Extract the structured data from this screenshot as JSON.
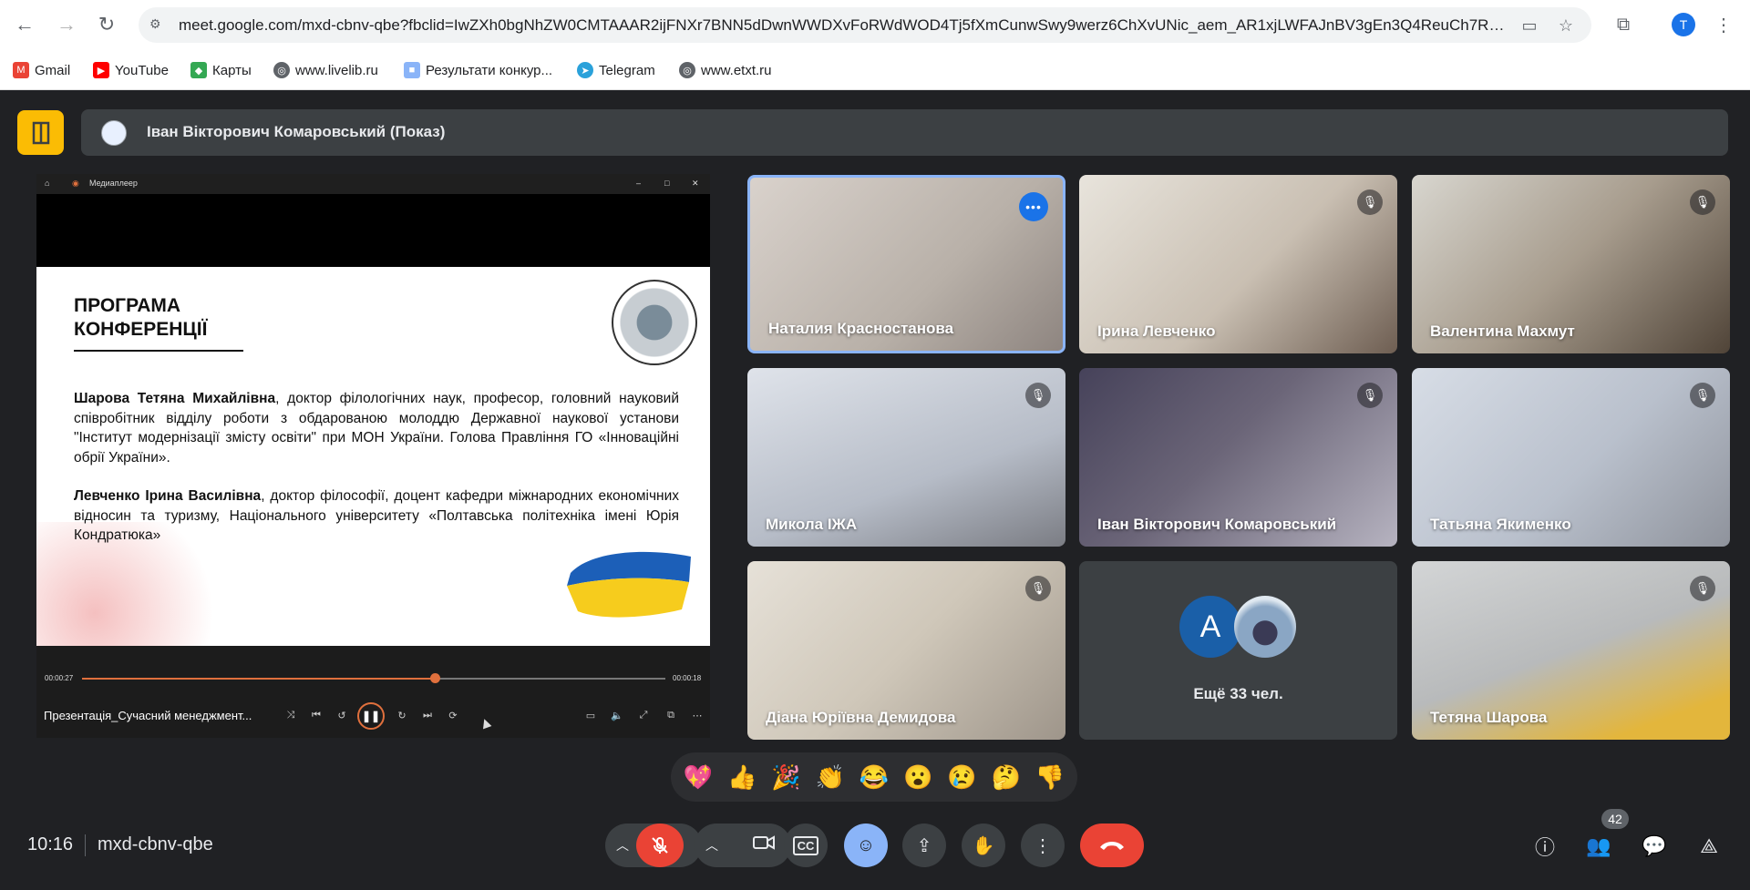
{
  "browser": {
    "url": "meet.google.com/mxd-cbnv-qbe?fbclid=IwZXh0bgNhZW0CMTAAAR2ijFNXr7BNN5dDwnWWDXvFoRWdWOD4Tj5fXmCunwSwy9werz6ChXvUNic_aem_AR1xjLWFAJnBV3gEn3Q4ReuCh7Rq_...",
    "profile_initial": "T",
    "bookmarks": [
      {
        "label": "Gmail",
        "color": "#ea4335"
      },
      {
        "label": "YouTube",
        "color": "#ff0000"
      },
      {
        "label": "Карты",
        "color": "#34a853"
      },
      {
        "label": "www.livelib.ru",
        "color": "#5f6368"
      },
      {
        "label": "Результати конкур...",
        "color": "#8ab4f8"
      },
      {
        "label": "Telegram",
        "color": "#2aa1da"
      },
      {
        "label": "www.etxt.ru",
        "color": "#5f6368"
      }
    ]
  },
  "meet": {
    "presenter_title": "Іван Вікторович Комаровський (Показ)",
    "media_player": {
      "app_name": "Медиаплеер",
      "time_elapsed": "00:00:27",
      "time_remaining": "00:00:18",
      "progress": 0.605,
      "file_name": "Презентація_Сучасний менеджмент..."
    },
    "slide": {
      "heading_line1": "ПРОГРАМА",
      "heading_line2": "КОНФЕРЕНЦІЇ",
      "p1_name": "Шарова Тетяна Михайлівна",
      "p1_text": ", доктор філологічних наук, професор, головний науковий співробітник відділу роботи з обдарованою молоддю Державної наукової установи \"Інститут модернізації змісту освіти\" при МОН України. Голова Правління ГО «Інноваційні обрії України».",
      "p2_name": "Левченко Ірина Василівна",
      "p2_text": ", доктор філософії, доцент кафедри міжнародних економічних відносин та туризму, Національного університету «Полтавська політехніка імені Юрія Кондратюка»"
    },
    "participants": [
      {
        "name": "Наталия Красностанова",
        "bg": "linear-gradient(135deg,#d9d2cc,#b8b0a8 60%,#8e8580)"
      },
      {
        "name": "Ірина Левченко",
        "bg": "linear-gradient(135deg,#e8e4dc,#c9bfb2 55%,#6e5e52)"
      },
      {
        "name": "Валентина Махмут",
        "bg": "linear-gradient(135deg,#d8d6cf,#a79c8d 50%,#504438)"
      },
      {
        "name": "Микола ІЖА",
        "bg": "linear-gradient(160deg,#dfe3ea,#b6bcc7 60%,#7b7d84)"
      },
      {
        "name": "Іван Вікторович Комаровський",
        "bg": "linear-gradient(135deg,#46425a,#6b6578 45%,#b6b3c0)"
      },
      {
        "name": "Татьяна Якименко",
        "bg": "linear-gradient(135deg,#d7dde6,#b9c0cc 55%,#8f939c)"
      },
      {
        "name": "Діана Юріївна Демидова",
        "bg": "linear-gradient(135deg,#e6e1d8,#cfc7b9 50%,#9e958a)"
      },
      {
        "name": "Тетяна Шарова",
        "bg": "linear-gradient(160deg,#d3d5d6,#b8babb 50%,#e3b63c 85%)"
      }
    ],
    "others_avatar_initial": "A",
    "others_label": "Ещё 33 чел.",
    "reactions": [
      "💖",
      "👍",
      "🎉",
      "👏",
      "😂",
      "😮",
      "😢",
      "🤔",
      "👎"
    ],
    "clock": "10:16",
    "meeting_code": "mxd-cbnv-qbe",
    "participant_count": "42",
    "colors": {
      "accent": "#8ab4f8",
      "end_call": "#ea4335",
      "present_badge": "#fbbc04"
    }
  }
}
